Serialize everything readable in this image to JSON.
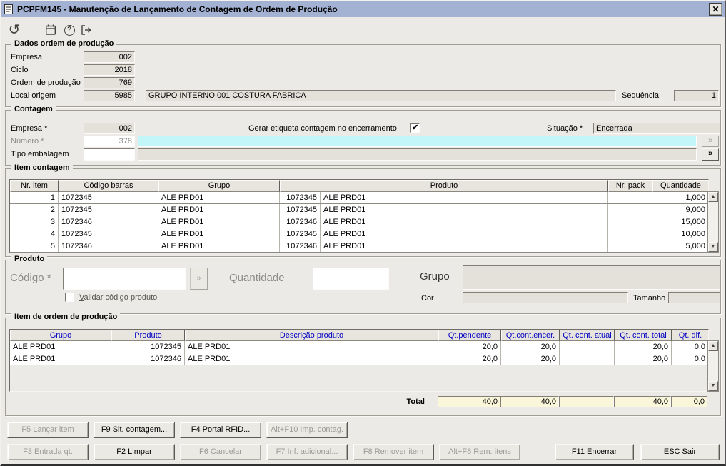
{
  "window": {
    "title": "PCPFM145 - Manutenção de Lançamento de Contagem de Ordem de Produção",
    "close": "✕"
  },
  "toolbar": {
    "icons": [
      "refresh-icon",
      "calendar-icon",
      "help-icon",
      "exit-icon"
    ],
    "help_glyph": "?",
    "refresh_glyph": "↺"
  },
  "dados_op": {
    "title": "Dados ordem de produção",
    "empresa_label": "Empresa",
    "empresa": "002",
    "ciclo_label": "Ciclo",
    "ciclo": "2018",
    "ordem_label": "Ordem de produção",
    "ordem": "769",
    "local_label": "Local origem",
    "local": "5985",
    "local_desc": "GRUPO INTERNO 001 COSTURA FABRICA",
    "sequencia_label": "Sequência",
    "sequencia": "1"
  },
  "contagem": {
    "title": "Contagem",
    "empresa_label": "Empresa *",
    "empresa": "002",
    "numero_label": "Número *",
    "numero": "378",
    "numero_desc": "",
    "tipo_label": "Tipo embalagem",
    "tipo": "",
    "tipo_desc": "",
    "etiqueta_label": "Gerar etiqueta contagem no encerramento",
    "etiqueta_checked": true,
    "situacao_label": "Situação *",
    "situacao": "Encerrada",
    "expand": "»"
  },
  "item_contagem": {
    "title": "Item contagem",
    "headers": [
      "Nr. item",
      "Código barras",
      "Grupo",
      "Produto",
      "Nr. pack",
      "Quantidade"
    ],
    "rows": [
      {
        "nr": "1",
        "barras": "1072345",
        "grupo": "ALE PRD01",
        "prod_cod": "1072345",
        "prod_nome": "ALE PRD01",
        "pack": "",
        "qtd": "1,000"
      },
      {
        "nr": "2",
        "barras": "1072345",
        "grupo": "ALE PRD01",
        "prod_cod": "1072345",
        "prod_nome": "ALE PRD01",
        "pack": "",
        "qtd": "9,000"
      },
      {
        "nr": "3",
        "barras": "1072346",
        "grupo": "ALE PRD01",
        "prod_cod": "1072346",
        "prod_nome": "ALE PRD01",
        "pack": "",
        "qtd": "15,000"
      },
      {
        "nr": "4",
        "barras": "1072345",
        "grupo": "ALE PRD01",
        "prod_cod": "1072345",
        "prod_nome": "ALE PRD01",
        "pack": "",
        "qtd": "10,000"
      },
      {
        "nr": "5",
        "barras": "1072346",
        "grupo": "ALE PRD01",
        "prod_cod": "1072346",
        "prod_nome": "ALE PRD01",
        "pack": "",
        "qtd": "5,000"
      }
    ]
  },
  "produto": {
    "title": "Produto",
    "codigo_label": "Código *",
    "codigo": "",
    "validar_prefix": "V",
    "validar_rest": "alidar código produto",
    "validar_checked": false,
    "quantidade_label": "Quantidade",
    "quantidade": "",
    "grupo_label": "Grupo",
    "grupo": "",
    "cor_label": "Cor",
    "cor": "",
    "tamanho_label": "Tamanho",
    "tamanho": "",
    "expand": "»"
  },
  "item_op": {
    "title": "Item de ordem de produção",
    "headers": [
      "Grupo",
      "Produto",
      "Descrição produto",
      "Qt.pendente",
      "Qt.cont.encer.",
      "Qt. cont. atual",
      "Qt. cont. total",
      "Qt. dif."
    ],
    "rows": [
      {
        "grupo": "ALE PRD01",
        "produto": "1072345",
        "descricao": "ALE PRD01",
        "pendente": "20,0",
        "encer": "20,0",
        "atual": "",
        "total": "20,0",
        "dif": "0,0"
      },
      {
        "grupo": "ALE PRD01",
        "produto": "1072346",
        "descricao": "ALE PRD01",
        "pendente": "20,0",
        "encer": "20,0",
        "atual": "",
        "total": "20,0",
        "dif": "0,0"
      }
    ],
    "total_label": "Total",
    "total": {
      "pendente": "40,0",
      "encer": "40,0",
      "atual": "",
      "total": "40,0",
      "dif": "0,0"
    }
  },
  "footer": {
    "row1": [
      {
        "key": "f5-lancar-item-button",
        "label": "F5 Lançar item",
        "enabled": false
      },
      {
        "key": "f9-sit-contagem-button",
        "label": "F9 Sit. contagem...",
        "enabled": true
      },
      {
        "key": "f4-portal-rfid-button",
        "label": "F4 Portal RFID...",
        "enabled": true
      },
      {
        "key": "alt-f10-imp-contag-button",
        "label": "Alt+F10 Imp. contag.",
        "enabled": false
      }
    ],
    "row2": [
      {
        "key": "f3-entrada-qt-button",
        "label": "F3 Entrada qt.",
        "enabled": false
      },
      {
        "key": "f2-limpar-button",
        "label": "F2 Limpar",
        "enabled": true
      },
      {
        "key": "f6-cancelar-button",
        "label": "F6 Cancelar",
        "enabled": false
      },
      {
        "key": "f7-inf-adicional-button",
        "label": "F7 Inf. adicional...",
        "enabled": false
      },
      {
        "key": "f8-remover-item-button",
        "label": "F8 Remover item",
        "enabled": false
      },
      {
        "key": "alt-f6-rem-itens-button",
        "label": "Alt+F6 Rem. itens",
        "enabled": false
      }
    ],
    "right": [
      {
        "key": "f11-encerrar-button",
        "label": "F11 Encerrar",
        "enabled": true
      },
      {
        "key": "esc-sair-button",
        "label": "ESC Sair",
        "enabled": true
      }
    ]
  },
  "colors": {
    "titlebar": "#a3b1d3",
    "cyan_field": "#c2f6f8",
    "total_bg": "#f9f6da",
    "header_blue": "#0000c0",
    "window_bg": "#eceae6"
  }
}
